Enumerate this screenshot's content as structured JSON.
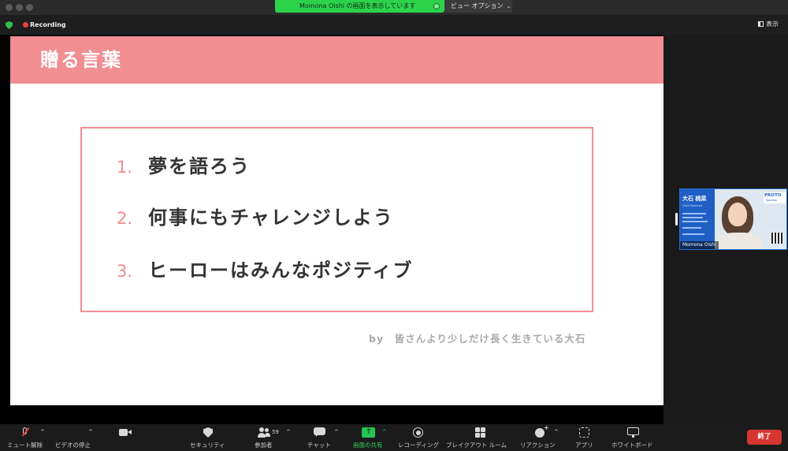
{
  "share_banner": {
    "text": "Momona Oishi の画面を表示しています",
    "view_options": "ビュー オプション",
    "view_options_chevron": "⌄"
  },
  "top_bar": {
    "recording": "Recording",
    "view_label": "表示"
  },
  "slide": {
    "title": "贈る言葉",
    "items": [
      {
        "num": "1.",
        "text": "夢を語ろう"
      },
      {
        "num": "2.",
        "text": "何事にもチャレンジしよう"
      },
      {
        "num": "3.",
        "text": "ヒーローはみんなポジティブ"
      }
    ],
    "by_line": "by　皆さんより少しだけ長く生きている大石"
  },
  "participant": {
    "label": "Momona Oishi",
    "card_name": "大石 桃菜",
    "card_sub": "Oishi Momona",
    "logo": "PROTO",
    "logo_sub": "Solution"
  },
  "toolbar": {
    "mute": "ミュート解除",
    "video": "ビデオの停止",
    "security": "セキュリティ",
    "participants": "参加者",
    "participants_count": "59",
    "chat": "チャット",
    "share": "画面の共有",
    "share_arrow": "↑",
    "record": "レコーディング",
    "breakout": "ブレイクアウト ルーム",
    "reactions": "リアクション",
    "reactions_plus": "+",
    "apps": "アプリ",
    "whiteboard": "ホワイトボード",
    "caret": "^",
    "end": "終了"
  },
  "colors": {
    "accent_pink": "#f08e92",
    "share_green": "#2dd24b",
    "end_red": "#d5362f",
    "recording_red": "#e8413c"
  }
}
